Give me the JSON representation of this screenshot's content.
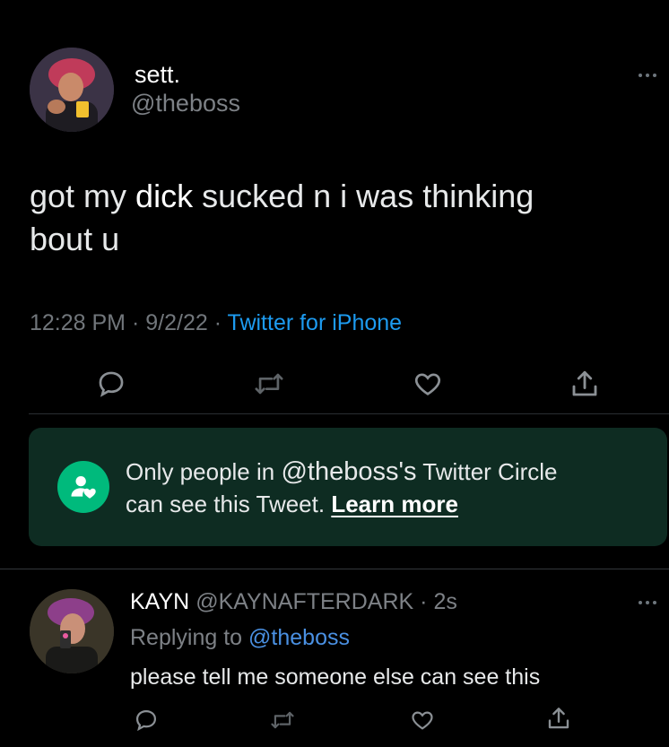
{
  "tweet": {
    "display_name": "sett.",
    "handle": "@theboss",
    "text_part1": "got my ",
    "text_emph": "dick",
    "text_part2": " sucked n i was thinking",
    "text_line2": "bout u",
    "time": "12:28 PM",
    "sep1": "·",
    "date": "9/2/22",
    "sep2": "·",
    "source": "Twitter for iPhone"
  },
  "actions": {
    "reply": "reply-icon",
    "retweet": "retweet-icon",
    "like": "heart-icon",
    "share": "share-icon"
  },
  "circle_notice": {
    "prefix": "Only people in ",
    "handle": "@theboss's",
    "suffix": " Twitter Circle",
    "line2": "can see this Tweet. ",
    "link": "Learn more",
    "colors": {
      "background": "#0e2c22",
      "icon_bg": "#00ba7c"
    }
  },
  "reply": {
    "display_name": "KAYN",
    "handle": "@KAYNAFTERDARK",
    "sep": "·",
    "age": "2s",
    "replying_label": "Replying to ",
    "replying_handle": "@theboss",
    "text": "please tell me someone else can see this"
  },
  "colors": {
    "accent": "#1d9bf0",
    "muted": "#71767b",
    "text": "#e7e9ea"
  }
}
